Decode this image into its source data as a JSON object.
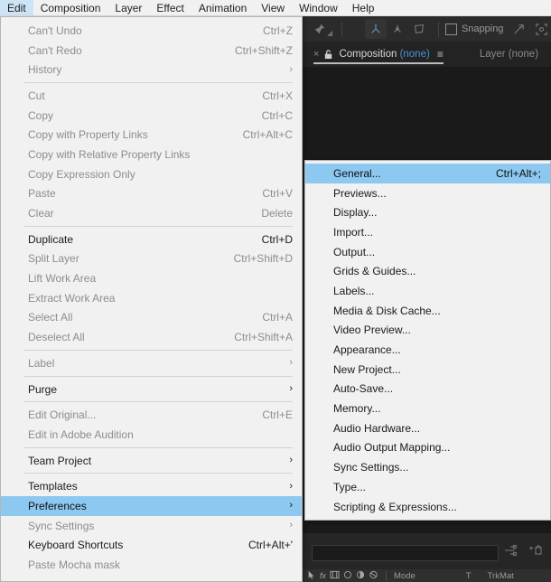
{
  "menubar": {
    "items": [
      {
        "label": "Edit",
        "selected": true
      },
      {
        "label": "Composition",
        "selected": false
      },
      {
        "label": "Layer",
        "selected": false
      },
      {
        "label": "Effect",
        "selected": false
      },
      {
        "label": "Animation",
        "selected": false
      },
      {
        "label": "View",
        "selected": false
      },
      {
        "label": "Window",
        "selected": false
      },
      {
        "label": "Help",
        "selected": false
      }
    ]
  },
  "toolbar": {
    "pin_icon": "puppet-pin-icon",
    "axis_world_icon": "axis-world-icon",
    "axis_view_icon": "axis-view-icon",
    "axis_local_icon": "axis-local-icon",
    "snapping_label": "Snapping",
    "snapping_checked": false,
    "magnet_icon": "snap-magnet-icon",
    "region_icon": "region-of-interest-icon"
  },
  "panel_tabs": {
    "close_glyph": "×",
    "lock_icon": "lock-icon",
    "composition_label": "Composition",
    "composition_value": "(none)",
    "panel_menu_glyph": "≡",
    "layer_tab": "Layer (none)"
  },
  "timeline": {
    "search_value": "",
    "parent_link_icon": "parent-link-icon",
    "shy_icon": "shy-layers-icon",
    "columns": {
      "mode": "Mode",
      "t": "T",
      "trkmat": "TrkMat"
    },
    "switch_icons": [
      "arrow-select-icon",
      "fx-icon",
      "filmstrip-icon",
      "circle-icon",
      "half-circle-icon",
      "shape-icon"
    ]
  },
  "edit_menu": {
    "rows": [
      {
        "label": "Can't Undo",
        "accel": "Ctrl+Z",
        "state": "disabled",
        "arrow": false
      },
      {
        "label": "Can't Redo",
        "accel": "Ctrl+Shift+Z",
        "state": "disabled",
        "arrow": false
      },
      {
        "label": "History",
        "accel": "",
        "state": "disabled",
        "arrow": true
      },
      {
        "separator": true
      },
      {
        "label": "Cut",
        "accel": "Ctrl+X",
        "state": "disabled",
        "arrow": false
      },
      {
        "label": "Copy",
        "accel": "Ctrl+C",
        "state": "disabled",
        "arrow": false
      },
      {
        "label": "Copy with Property Links",
        "accel": "Ctrl+Alt+C",
        "state": "disabled",
        "arrow": false
      },
      {
        "label": "Copy with Relative Property Links",
        "accel": "",
        "state": "disabled",
        "arrow": false
      },
      {
        "label": "Copy Expression Only",
        "accel": "",
        "state": "disabled",
        "arrow": false
      },
      {
        "label": "Paste",
        "accel": "Ctrl+V",
        "state": "disabled",
        "arrow": false
      },
      {
        "label": "Clear",
        "accel": "Delete",
        "state": "disabled",
        "arrow": false
      },
      {
        "separator": true
      },
      {
        "label": "Duplicate",
        "accel": "Ctrl+D",
        "state": "enabled",
        "arrow": false
      },
      {
        "label": "Split Layer",
        "accel": "Ctrl+Shift+D",
        "state": "disabled",
        "arrow": false
      },
      {
        "label": "Lift Work Area",
        "accel": "",
        "state": "disabled",
        "arrow": false
      },
      {
        "label": "Extract Work Area",
        "accel": "",
        "state": "disabled",
        "arrow": false
      },
      {
        "label": "Select All",
        "accel": "Ctrl+A",
        "state": "disabled",
        "arrow": false
      },
      {
        "label": "Deselect All",
        "accel": "Ctrl+Shift+A",
        "state": "disabled",
        "arrow": false
      },
      {
        "separator": true
      },
      {
        "label": "Label",
        "accel": "",
        "state": "disabled",
        "arrow": true
      },
      {
        "separator": true
      },
      {
        "label": "Purge",
        "accel": "",
        "state": "enabled",
        "arrow": true
      },
      {
        "separator": true
      },
      {
        "label": "Edit Original...",
        "accel": "Ctrl+E",
        "state": "disabled",
        "arrow": false
      },
      {
        "label": "Edit in Adobe Audition",
        "accel": "",
        "state": "disabled",
        "arrow": false
      },
      {
        "separator": true
      },
      {
        "label": "Team Project",
        "accel": "",
        "state": "enabled",
        "arrow": true
      },
      {
        "separator": true
      },
      {
        "label": "Templates",
        "accel": "",
        "state": "enabled",
        "arrow": true
      },
      {
        "label": "Preferences",
        "accel": "",
        "state": "highlight",
        "arrow": true
      },
      {
        "label": "Sync Settings",
        "accel": "",
        "state": "disabled",
        "arrow": true
      },
      {
        "label": "Keyboard Shortcuts",
        "accel": "Ctrl+Alt+'",
        "state": "enabled",
        "arrow": false
      },
      {
        "label": "Paste Mocha mask",
        "accel": "",
        "state": "disabled",
        "arrow": false
      }
    ]
  },
  "preferences_submenu": {
    "rows": [
      {
        "label": "General...",
        "accel": "Ctrl+Alt+;",
        "state": "highlight"
      },
      {
        "label": "Previews...",
        "accel": "",
        "state": "enabled"
      },
      {
        "label": "Display...",
        "accel": "",
        "state": "enabled"
      },
      {
        "label": "Import...",
        "accel": "",
        "state": "enabled"
      },
      {
        "label": "Output...",
        "accel": "",
        "state": "enabled"
      },
      {
        "label": "Grids & Guides...",
        "accel": "",
        "state": "enabled"
      },
      {
        "label": "Labels...",
        "accel": "",
        "state": "enabled"
      },
      {
        "label": "Media & Disk Cache...",
        "accel": "",
        "state": "enabled"
      },
      {
        "label": "Video Preview...",
        "accel": "",
        "state": "enabled"
      },
      {
        "label": "Appearance...",
        "accel": "",
        "state": "enabled"
      },
      {
        "label": "New Project...",
        "accel": "",
        "state": "enabled"
      },
      {
        "label": "Auto-Save...",
        "accel": "",
        "state": "enabled"
      },
      {
        "label": "Memory...",
        "accel": "",
        "state": "enabled"
      },
      {
        "label": "Audio Hardware...",
        "accel": "",
        "state": "enabled"
      },
      {
        "label": "Audio Output Mapping...",
        "accel": "",
        "state": "enabled"
      },
      {
        "label": "Sync Settings...",
        "accel": "",
        "state": "enabled"
      },
      {
        "label": "Type...",
        "accel": "",
        "state": "enabled"
      },
      {
        "label": "Scripting & Expressions...",
        "accel": "",
        "state": "enabled"
      }
    ]
  },
  "colors": {
    "menu_bg": "#f1f1f1",
    "highlight_blue": "#8dc8f0",
    "menubar_selected": "#cde4f7",
    "accent_blue": "#4a90d9",
    "app_dark": "#1d1d1d"
  }
}
